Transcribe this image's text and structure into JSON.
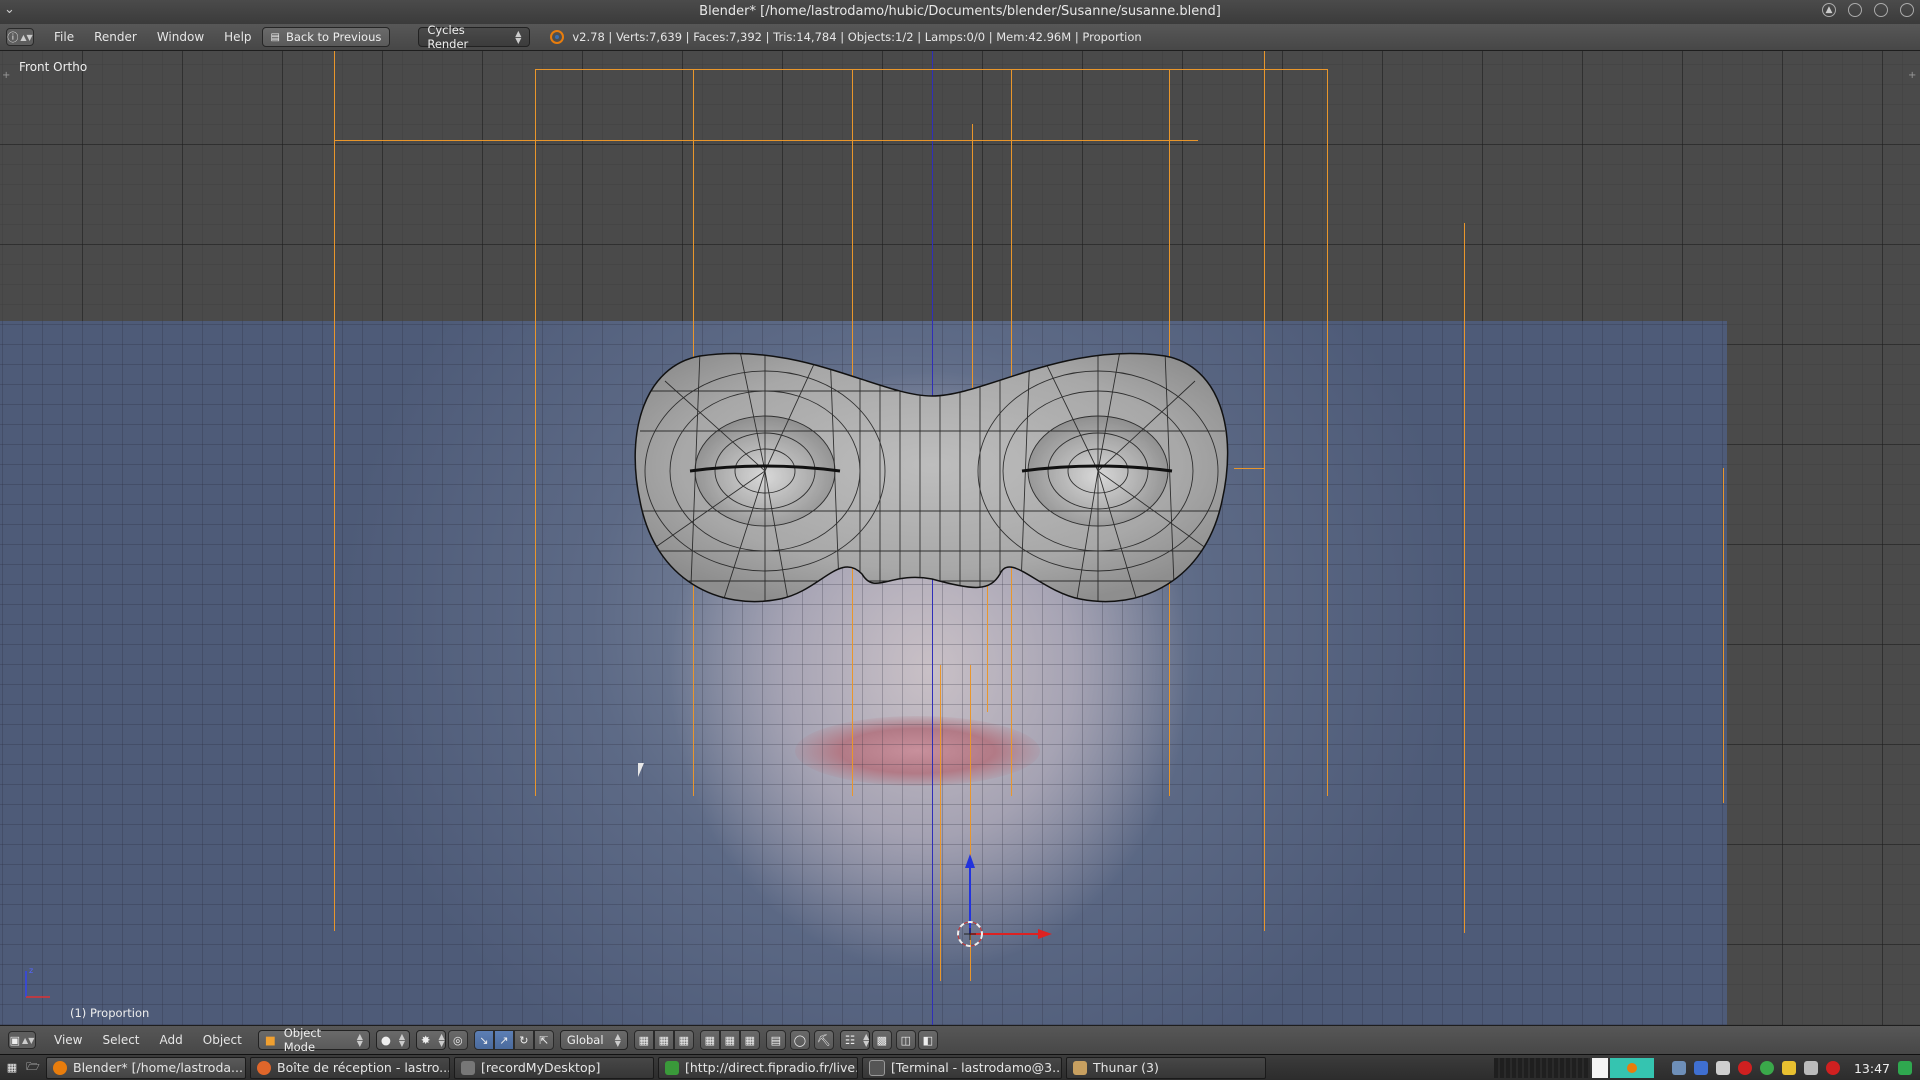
{
  "window": {
    "title": "Blender* [/home/lastrodamo/hubic/Documents/blender/Susanne/susanne.blend]"
  },
  "info_header": {
    "editor_icon": "info-icon",
    "menus": [
      "File",
      "Render",
      "Window",
      "Help"
    ],
    "back_button": "Back to Previous",
    "render_engine": "Cycles Render",
    "stats": "v2.78 | Verts:7,639 | Faces:7,392 | Tris:14,784 | Objects:1/2 | Lamps:0/0 | Mem:42.96M | Proportion"
  },
  "viewport": {
    "view_name": "Front Ortho",
    "object_label": "(1) Proportion"
  },
  "view3d_header": {
    "menus": [
      "View",
      "Select",
      "Add",
      "Object"
    ],
    "mode": "Object Mode",
    "orientation": "Global"
  },
  "taskbar": {
    "tasks": [
      {
        "label": "Blender* [/home/lastroda...",
        "icon": "blender-icon",
        "color": "#e87d0d"
      },
      {
        "label": "Boîte de réception - lastro...",
        "icon": "firefox-icon",
        "color": "#e0662a"
      },
      {
        "label": "[recordMyDesktop]",
        "icon": "window-icon",
        "color": "#888888"
      },
      {
        "label": "[http://direct.fipradio.fr/live...",
        "icon": "audio-player-icon",
        "color": "#3a9a3a"
      },
      {
        "label": "[Terminal - lastrodamo@3...",
        "icon": "terminal-icon",
        "color": "#555555"
      },
      {
        "label": "Thunar (3)",
        "icon": "folder-icon",
        "color": "#c8a060"
      }
    ],
    "clock": "13:47"
  }
}
